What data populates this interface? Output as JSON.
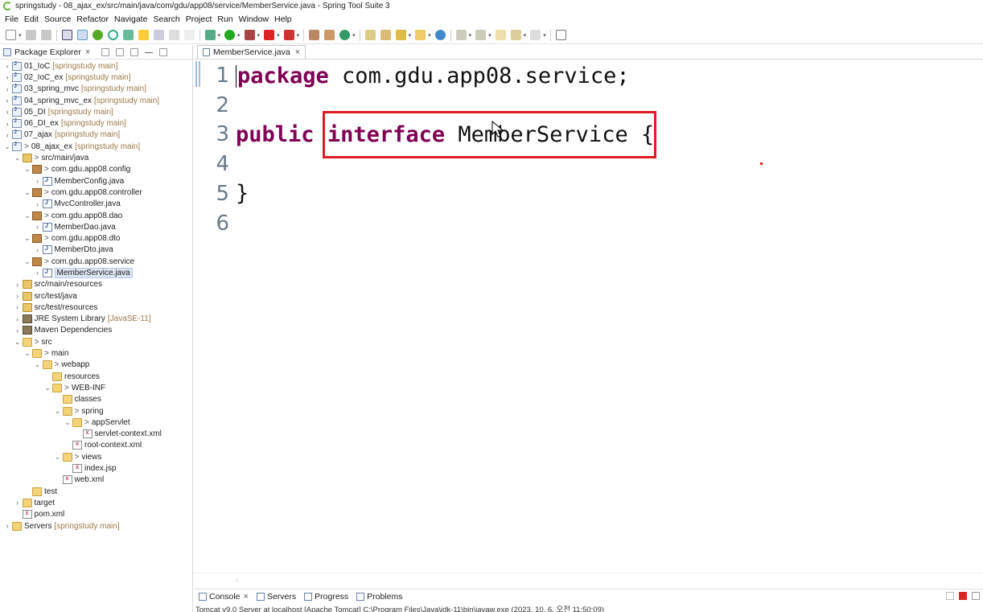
{
  "window": {
    "title": "springstudy - 08_ajax_ex/src/main/java/com/gdu/app08/service/MemberService.java - Spring Tool Suite 3"
  },
  "menu": [
    "File",
    "Edit",
    "Source",
    "Refactor",
    "Navigate",
    "Search",
    "Project",
    "Run",
    "Window",
    "Help"
  ],
  "package_explorer": {
    "tab_label": "Package Explorer",
    "tree": [
      {
        "label": "01_IoC",
        "dec": "[springstudy main]",
        "indent": 0,
        "tw": ">",
        "icon": "project"
      },
      {
        "label": "02_IoC_ex",
        "dec": "[springstudy main]",
        "indent": 0,
        "tw": ">",
        "icon": "project"
      },
      {
        "label": "03_spring_mvc",
        "dec": "[springstudy main]",
        "indent": 0,
        "tw": ">",
        "icon": "project"
      },
      {
        "label": "04_spring_mvc_ex",
        "dec": "[springstudy main]",
        "indent": 0,
        "tw": ">",
        "icon": "project"
      },
      {
        "label": "05_DI",
        "dec": "[springstudy main]",
        "indent": 0,
        "tw": ">",
        "icon": "project"
      },
      {
        "label": "06_DI_ex",
        "dec": "[springstudy main]",
        "indent": 0,
        "tw": ">",
        "icon": "project"
      },
      {
        "label": "07_ajax",
        "dec": "[springstudy main]",
        "indent": 0,
        "tw": ">",
        "icon": "project"
      },
      {
        "label": "08_ajax_ex",
        "dec": "[springstudy main]",
        "indent": 0,
        "tw": "v",
        "icon": "project",
        "pre": ">"
      },
      {
        "label": "src/main/java",
        "dec": "",
        "indent": 1,
        "tw": "v",
        "icon": "srcfolder",
        "pre": ">"
      },
      {
        "label": "com.gdu.app08.config",
        "dec": "",
        "indent": 2,
        "tw": "v",
        "icon": "package",
        "pre": ">"
      },
      {
        "label": "MemberConfig.java",
        "dec": "",
        "indent": 3,
        "tw": ">",
        "icon": "javafile"
      },
      {
        "label": "com.gdu.app08.controller",
        "dec": "",
        "indent": 2,
        "tw": "v",
        "icon": "package",
        "pre": ">"
      },
      {
        "label": "MvcController.java",
        "dec": "",
        "indent": 3,
        "tw": ">",
        "icon": "javafile"
      },
      {
        "label": "com.gdu.app08.dao",
        "dec": "",
        "indent": 2,
        "tw": "v",
        "icon": "package",
        "pre": ">"
      },
      {
        "label": "MemberDao.java",
        "dec": "",
        "indent": 3,
        "tw": ">",
        "icon": "javafile"
      },
      {
        "label": "com.gdu.app08.dto",
        "dec": "",
        "indent": 2,
        "tw": "v",
        "icon": "package",
        "pre": ">"
      },
      {
        "label": "MemberDto.java",
        "dec": "",
        "indent": 3,
        "tw": ">",
        "icon": "javafile"
      },
      {
        "label": "com.gdu.app08.service",
        "dec": "",
        "indent": 2,
        "tw": "v",
        "icon": "package",
        "pre": ">"
      },
      {
        "label": "MemberService.java",
        "dec": "",
        "indent": 3,
        "tw": ">",
        "icon": "javafile",
        "selected": true
      },
      {
        "label": "src/main/resources",
        "dec": "",
        "indent": 1,
        "tw": ">",
        "icon": "srcfolder"
      },
      {
        "label": "src/test/java",
        "dec": "",
        "indent": 1,
        "tw": ">",
        "icon": "srcfolder"
      },
      {
        "label": "src/test/resources",
        "dec": "",
        "indent": 1,
        "tw": ">",
        "icon": "srcfolder"
      },
      {
        "label": "JRE System Library",
        "dec": "[JavaSE-11]",
        "indent": 1,
        "tw": ">",
        "icon": "library"
      },
      {
        "label": "Maven Dependencies",
        "dec": "",
        "indent": 1,
        "tw": ">",
        "icon": "library"
      },
      {
        "label": "src",
        "dec": "",
        "indent": 1,
        "tw": "v",
        "icon": "folder",
        "pre": ">"
      },
      {
        "label": "main",
        "dec": "",
        "indent": 2,
        "tw": "v",
        "icon": "folder",
        "pre": ">"
      },
      {
        "label": "webapp",
        "dec": "",
        "indent": 3,
        "tw": "v",
        "icon": "folder",
        "pre": ">"
      },
      {
        "label": "resources",
        "dec": "",
        "indent": 4,
        "tw": "",
        "icon": "folder"
      },
      {
        "label": "WEB-INF",
        "dec": "",
        "indent": 4,
        "tw": "v",
        "icon": "folder",
        "pre": ">"
      },
      {
        "label": "classes",
        "dec": "",
        "indent": 5,
        "tw": "",
        "icon": "folder"
      },
      {
        "label": "spring",
        "dec": "",
        "indent": 5,
        "tw": "v",
        "icon": "folder",
        "pre": ">"
      },
      {
        "label": "appServlet",
        "dec": "",
        "indent": 6,
        "tw": "v",
        "icon": "folder",
        "pre": ">"
      },
      {
        "label": "servlet-context.xml",
        "dec": "",
        "indent": 7,
        "tw": "",
        "icon": "xml"
      },
      {
        "label": "root-context.xml",
        "dec": "",
        "indent": 6,
        "tw": "",
        "icon": "xml"
      },
      {
        "label": "views",
        "dec": "",
        "indent": 5,
        "tw": "v",
        "icon": "folder",
        "pre": ">"
      },
      {
        "label": "index.jsp",
        "dec": "",
        "indent": 6,
        "tw": "",
        "icon": "xml"
      },
      {
        "label": "web.xml",
        "dec": "",
        "indent": 5,
        "tw": "",
        "icon": "xml"
      },
      {
        "label": "test",
        "dec": "",
        "indent": 2,
        "tw": "",
        "icon": "folder"
      },
      {
        "label": "target",
        "dec": "",
        "indent": 1,
        "tw": ">",
        "icon": "folder"
      },
      {
        "label": "pom.xml",
        "dec": "",
        "indent": 1,
        "tw": "",
        "icon": "xml"
      },
      {
        "label": "Servers",
        "dec": "[springstudy main]",
        "indent": 0,
        "tw": ">",
        "icon": "folder"
      }
    ]
  },
  "editor": {
    "tab_label": "MemberService.java",
    "lines": [
      {
        "no": "1",
        "parts": [
          {
            "t": "package",
            "kw": true
          },
          {
            "t": " com.gdu.app08.service;"
          }
        ]
      },
      {
        "no": "2",
        "parts": []
      },
      {
        "no": "3",
        "parts": [
          {
            "t": "public",
            "kw": true
          },
          {
            "t": " "
          },
          {
            "t": "interface",
            "kw": true
          },
          {
            "t": " MemberService {"
          }
        ]
      },
      {
        "no": "4",
        "parts": []
      },
      {
        "no": "5",
        "parts": [
          {
            "t": "}"
          }
        ]
      },
      {
        "no": "6",
        "parts": []
      }
    ]
  },
  "bottom_panel": {
    "tabs": [
      "Console",
      "Servers",
      "Progress",
      "Problems"
    ],
    "console_text": "Tomcat v9.0 Server at localhost [Apache Tomcat] C:\\Program Files\\Java\\jdk-11\\bin\\javaw.exe  (2023. 10. 6. 오전 11:50:09)"
  },
  "colors": {
    "keyword": "#7f0055",
    "highlight_box": "#e01b24"
  }
}
